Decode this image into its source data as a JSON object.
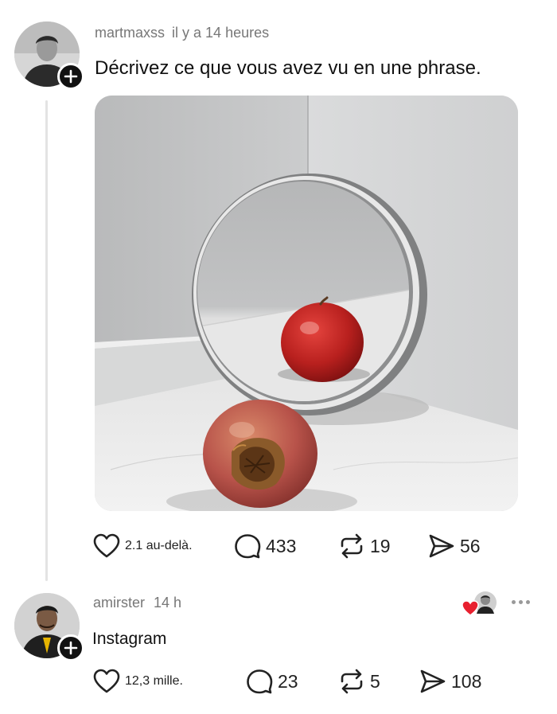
{
  "posts": [
    {
      "username": "martmaxss",
      "time": "il y a 14 heures",
      "text": "Décrivez ce que vous avez vu en une phrase.",
      "image_description_icon": "photo-apple-mirror",
      "actions": {
        "likes": "2.1 au-delà.",
        "comments": "433",
        "reposts": "19",
        "shares": "56"
      }
    },
    {
      "username": "amirster",
      "time": "14 h",
      "text": "Instagram",
      "actions": {
        "likes": "12,3 mille.",
        "comments": "23",
        "reposts": "5",
        "shares": "108"
      }
    }
  ],
  "icons": {
    "like": "heart-icon",
    "comment": "comment-bubble-icon",
    "repost": "repost-icon",
    "share": "send-icon",
    "follow": "plus-icon",
    "more": "more-dots-icon",
    "liked_heart": "red-heart-icon"
  },
  "colors": {
    "text": "#111111",
    "meta": "#777777",
    "thread_line": "#e3e3e3",
    "liked_heart": "#e8202f",
    "badge": "#111111"
  }
}
